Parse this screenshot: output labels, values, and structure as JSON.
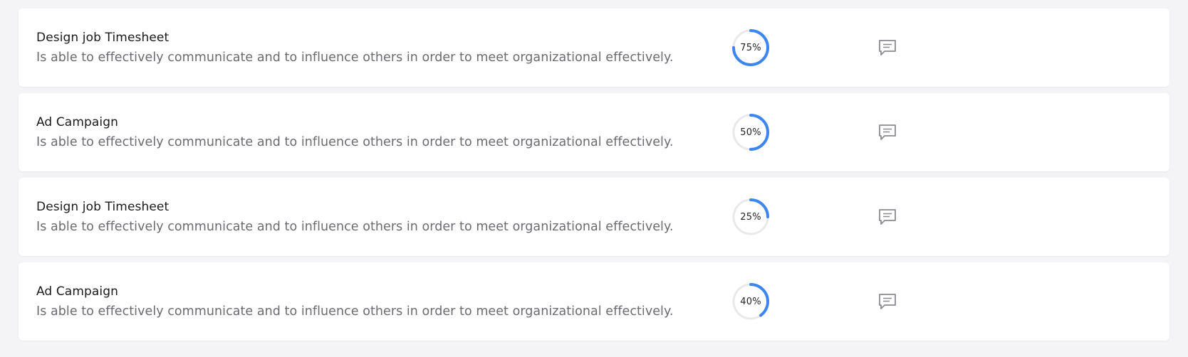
{
  "accent_color": "#3d86f0",
  "track_color": "#e9e9ec",
  "items": [
    {
      "title": "Design job Timesheet",
      "description": "Is able to effectively communicate and to influence others in order to meet organizational effectively.",
      "progress": 75,
      "progress_label": "75%",
      "icon": "comment-icon"
    },
    {
      "title": "Ad Campaign",
      "description": "Is able to effectively communicate and to influence others in order to meet organizational effectively.",
      "progress": 50,
      "progress_label": "50%",
      "icon": "comment-icon"
    },
    {
      "title": "Design job Timesheet",
      "description": "Is able to effectively communicate and to influence others in order to meet organizational effectively.",
      "progress": 25,
      "progress_label": "25%",
      "icon": "comment-icon"
    },
    {
      "title": "Ad Campaign",
      "description": "Is able to effectively communicate and to influence others in order to meet organizational effectively.",
      "progress": 40,
      "progress_label": "40%",
      "icon": "comment-icon"
    }
  ]
}
